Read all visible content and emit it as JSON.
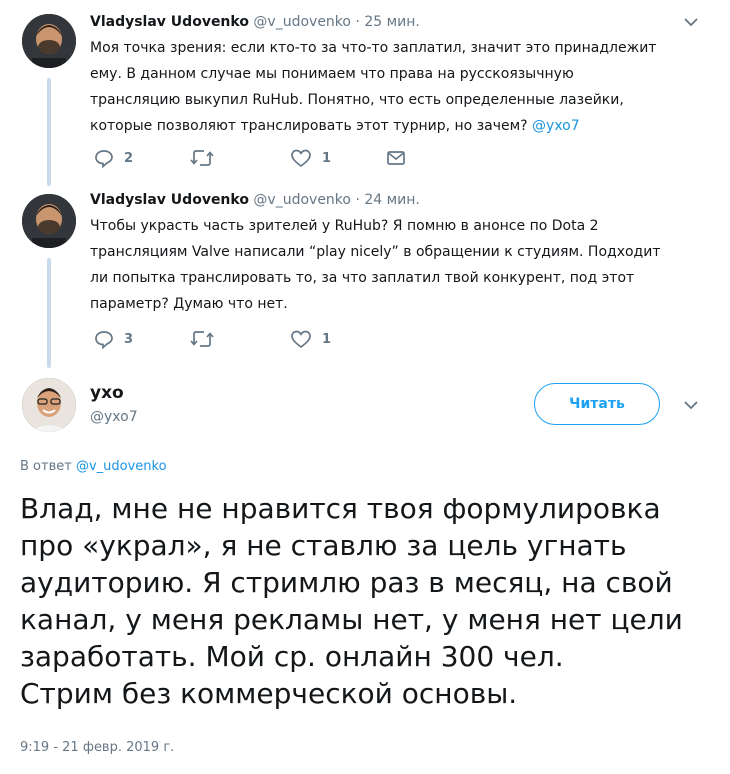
{
  "tweets": [
    {
      "name": "Vladyslav Udovenko",
      "handle": "@v_udovenko",
      "sep": "·",
      "time": "25 мин.",
      "lines": [
        "Моя точка зрения: если кто-то за что-то заплатил, значит это принадлежит",
        "ему. В данном случае мы понимаем что права на русскоязычную",
        "трансляцию выкупил RuHub. Понятно, что есть определенные лазейки,",
        "которые позволяют транслировать этот турнир, но зачем?"
      ],
      "mention": "@yxo7",
      "reply_count": "2",
      "retweet_count": "",
      "like_count": "1"
    },
    {
      "name": "Vladyslav Udovenko",
      "handle": "@v_udovenko",
      "sep": "·",
      "time": "24 мин.",
      "lines": [
        "Чтобы украсть часть зрителей у RuHub? Я помню в анонсе по Dota 2",
        "трансляциям Valve написали “play nicely” в обращении к студиям. Подходит",
        "ли попытка транслировать то, за что заплатил твой конкурент, под этот",
        "параметр? Думаю что нет."
      ],
      "reply_count": "3",
      "retweet_count": "",
      "like_count": "1"
    }
  ],
  "main": {
    "name": "ухо",
    "handle": "@yxo7",
    "follow_label": "Читать",
    "reply_prefix": "В ответ",
    "reply_to": "@v_udovenko",
    "text_lines": [
      "Влад, мне не нравится твоя формулировка",
      "про «украл», я не ставлю за цель угнать",
      "аудиторию. Я стримлю раз в месяц, на свой",
      "канал, у меня рекламы нет, у меня нет цели",
      "заработать. Мой ср. онлайн 300 чел.",
      "Стрим без коммерческой основы."
    ],
    "timestamp": "9:19 - 21 февр. 2019 г."
  },
  "icons": {
    "reply": "reply-icon",
    "retweet": "retweet-icon",
    "like": "heart-icon",
    "dm": "envelope-icon",
    "caret": "chevron-down-icon"
  },
  "colors": {
    "link": "#1b95e0",
    "follow": "#1da1f2",
    "muted": "#657786",
    "thread_line": "#c9dbea"
  }
}
